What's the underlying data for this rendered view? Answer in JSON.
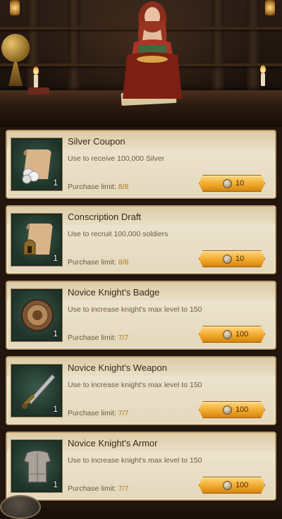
{
  "shop": {
    "items": [
      {
        "name": "Silver Coupon",
        "description": "Use to receive 100,000 Silver",
        "quantity": "1",
        "limit_label": "Purchase limit:",
        "limit_value": "8/8",
        "price": "10",
        "icon": "silver-coupon-icon"
      },
      {
        "name": "Conscription Draft",
        "description": "Use to recruit 100,000 soldiers",
        "quantity": "1",
        "limit_label": "Purchase limit:",
        "limit_value": "8/8",
        "price": "10",
        "icon": "conscription-draft-icon"
      },
      {
        "name": "Novice Knight's Badge",
        "description": "Use to increase knight's max level to 150",
        "quantity": "1",
        "limit_label": "Purchase limit:",
        "limit_value": "7/7",
        "price": "100",
        "icon": "knight-badge-icon"
      },
      {
        "name": "Novice Knight's Weapon",
        "description": "Use to increase knight's max level to 150",
        "quantity": "1",
        "limit_label": "Purchase limit:",
        "limit_value": "7/7",
        "price": "100",
        "icon": "knight-weapon-icon"
      },
      {
        "name": "Novice Knight's Armor",
        "description": "Use to increase knight's max level to 150",
        "quantity": "1",
        "limit_label": "Purchase limit:",
        "limit_value": "7/7",
        "price": "100",
        "icon": "knight-armor-icon"
      }
    ]
  },
  "colors": {
    "card_bg": "#efe7d4",
    "button_gold": "#f1a92c",
    "limit_value": "#b57a1a",
    "icon_bg": "#2b4539"
  }
}
